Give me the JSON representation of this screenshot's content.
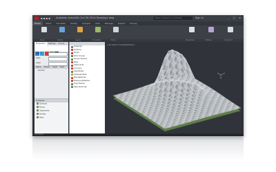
{
  "app": {
    "title": "Autodesk AutoCAD Civil 3D 2014   Drawing1.dwg",
    "search_placeholder": "Type a keyword or phrase",
    "user": "Sign In",
    "window_buttons": "_ □ ×"
  },
  "ribbon": {
    "tabs": [
      "Home",
      "Insert",
      "Annotate",
      "Modify",
      "Analyze",
      "View",
      "Manage",
      "Output",
      "Survey"
    ],
    "active_tab": "Home",
    "groups": [
      "Draw",
      "Modify",
      "Layers",
      "Annotation",
      "Block",
      "Properties",
      "Utilities",
      "Clipboard"
    ],
    "icon_colors": [
      "#d8dde3",
      "#6aa3d9",
      "#e3a33c",
      "#9cb86a",
      "#cfd4da",
      "#e0e0e0",
      "#b7a3d6",
      "#d8dde3"
    ]
  },
  "left_panel": {
    "tabs": [
      "Prospector",
      "Settings",
      "Survey"
    ],
    "active_tab": "Prospector",
    "swatches": [
      "#2e7dd1",
      "#3c9be0",
      "#d93a2f",
      "#3aa14a",
      "#2f2f2f"
    ],
    "fields": [
      {
        "label": "Name"
      },
      {
        "label": "Style"
      },
      {
        "label": "Layer"
      }
    ],
    "table_headers": [
      "Name",
      "Status",
      "Layer",
      "Desc"
    ],
    "table_rows": [
      "Surface"
    ],
    "bottom_header": "Toolspace",
    "bottom_items": [
      "Surfaces",
      "Points",
      "Alignments",
      "Profiles",
      "Sites"
    ]
  },
  "tree": {
    "items": [
      {
        "label": "Drawing1",
        "color": "#6e7a85"
      },
      {
        "label": "Surfaces",
        "color": "#c94040"
      },
      {
        "label": "Points",
        "color": "#c94040"
      },
      {
        "label": "Point Groups",
        "color": "#5a8d3c"
      },
      {
        "label": "Survey Queries",
        "color": "#5a8d3c"
      },
      {
        "label": "Sites",
        "color": "#c94040"
      },
      {
        "label": "Alignments",
        "color": "#c94040"
      },
      {
        "label": "Corridors",
        "color": "#c94040"
      },
      {
        "label": "Assemblies",
        "color": "#5a8d3c"
      },
      {
        "label": "Subassemblies",
        "color": "#c9a23c"
      },
      {
        "label": "Pipe Networks",
        "color": "#c94040"
      },
      {
        "label": "Pressure Networks",
        "color": "#c94040"
      },
      {
        "label": "View Frames",
        "color": "#5a8d3c"
      },
      {
        "label": "Data Shortcuts",
        "color": "#6e7a85"
      }
    ]
  },
  "viewport": {
    "label": "[-][Custom View][Realistic]",
    "mesh_color": "#e2e5e9",
    "ground_color": "#5f7d4a",
    "background": "#30343a"
  },
  "statusbar": {
    "text": "Command:"
  }
}
